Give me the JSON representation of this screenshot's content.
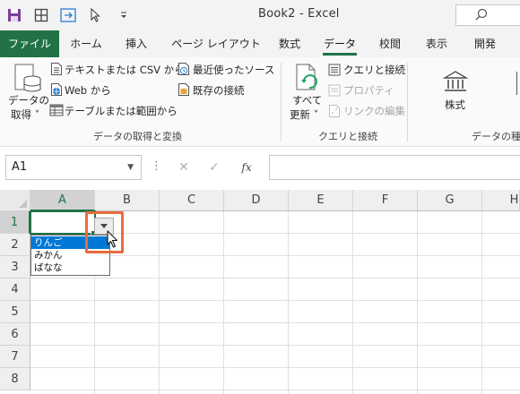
{
  "window": {
    "title": "Book2  -  Excel",
    "search_placeholder": ""
  },
  "ribbon_tabs": [
    {
      "label": "ファイル"
    },
    {
      "label": "ホーム"
    },
    {
      "label": "挿入"
    },
    {
      "label": "ページ レイアウト"
    },
    {
      "label": "数式"
    },
    {
      "label": "データ"
    },
    {
      "label": "校閲"
    },
    {
      "label": "表示"
    },
    {
      "label": "開発"
    }
  ],
  "active_tab": "データ",
  "ribbon": {
    "get_data": {
      "button_line1": "データの",
      "button_line2": "取得 ˅",
      "text_csv": "テキストまたは CSV から",
      "web": "Web から",
      "table_range": "テーブルまたは範囲から",
      "recent_sources": "最近使ったソース",
      "existing_connections": "既存の接続",
      "group_label": "データの取得と変換"
    },
    "queries": {
      "refresh_all_line1": "すべて",
      "refresh_all_line2": "更新 ˅",
      "queries_connections": "クエリと接続",
      "properties": "プロパティ",
      "edit_links": "リンクの編集",
      "group_label": "クエリと接続"
    },
    "data_types": {
      "stocks": "株式",
      "group_label": "データの種類"
    }
  },
  "formula_bar": {
    "name_box": "A1",
    "cancel_symbol": "✕",
    "enter_symbol": "✓",
    "fx_label": "fx",
    "formula": ""
  },
  "sheet": {
    "columns": [
      "A",
      "B",
      "C",
      "D",
      "E",
      "F",
      "G",
      "H"
    ],
    "rows": [
      "1",
      "2",
      "3",
      "4",
      "5",
      "6",
      "7",
      "8"
    ],
    "active_cell": "A1",
    "dropdown_options": [
      "りんご",
      "みかん",
      "ばなな"
    ],
    "selected_option": "りんご"
  },
  "colors": {
    "accent": "#217346",
    "highlight_box": "#e86c3f",
    "list_selection": "#0078d7"
  }
}
